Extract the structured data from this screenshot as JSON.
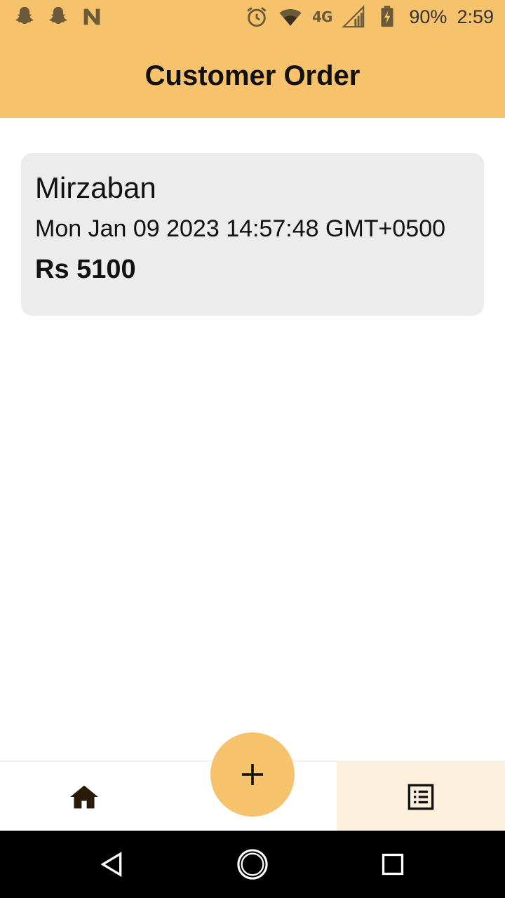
{
  "status_bar": {
    "left_icons": [
      "snapchat-icon",
      "snapchat-icon",
      "n-notification-icon"
    ],
    "right_icons": [
      "alarm-icon",
      "wifi-icon",
      "lte-icon",
      "signal-icon",
      "battery-charging-icon"
    ],
    "network_label": "4G",
    "battery": "90%",
    "time": "2:59"
  },
  "app_bar": {
    "title": "Customer Order"
  },
  "orders": [
    {
      "customer_name": "Mirzaban",
      "date": "Mon Jan 09 2023 14:57:48 GMT+0500",
      "total": "Rs 5100"
    }
  ],
  "bottom_nav": {
    "items": [
      {
        "icon": "home-icon",
        "active": false
      },
      {
        "icon": "list-icon",
        "active": true
      }
    ],
    "fab_icon": "plus-icon"
  },
  "system_nav": {
    "buttons": [
      "back-icon",
      "home-circle-icon",
      "recents-icon"
    ]
  },
  "colors": {
    "primary": "#f6c26b",
    "card_background": "#ececec",
    "active_tab_background": "#fcefdc",
    "text": "#111111"
  }
}
